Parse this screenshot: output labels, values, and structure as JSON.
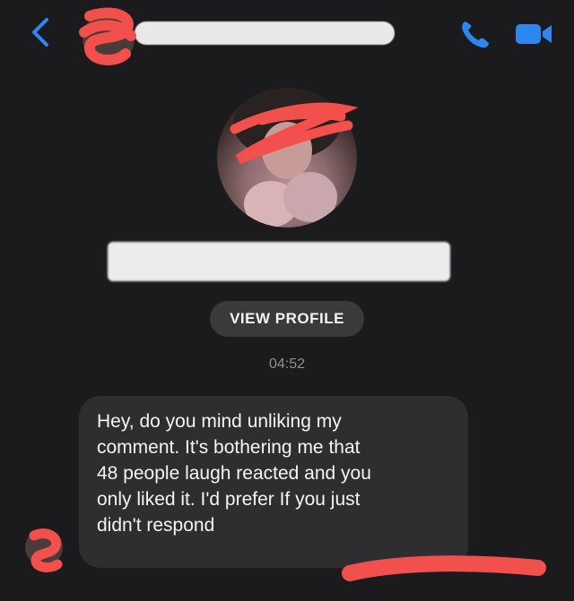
{
  "colors": {
    "accent": "#2e87f0",
    "background": "#1b1b1d",
    "bubble": "#2e2e30",
    "redaction_scribble": "#f2504c"
  },
  "header": {
    "back_icon": "chevron-left-icon",
    "call_icon": "phone-icon",
    "video_icon": "video-camera-icon"
  },
  "profile": {
    "view_profile_label": "VIEW PROFILE"
  },
  "conversation": {
    "timestamp": "04:52",
    "messages": [
      {
        "direction": "incoming",
        "text": "Hey, do you mind unliking my\ncomment. It's bothering me that\n48 people laugh reacted and you\nonly liked it. I'd prefer If you just\ndidn't respond"
      }
    ]
  }
}
